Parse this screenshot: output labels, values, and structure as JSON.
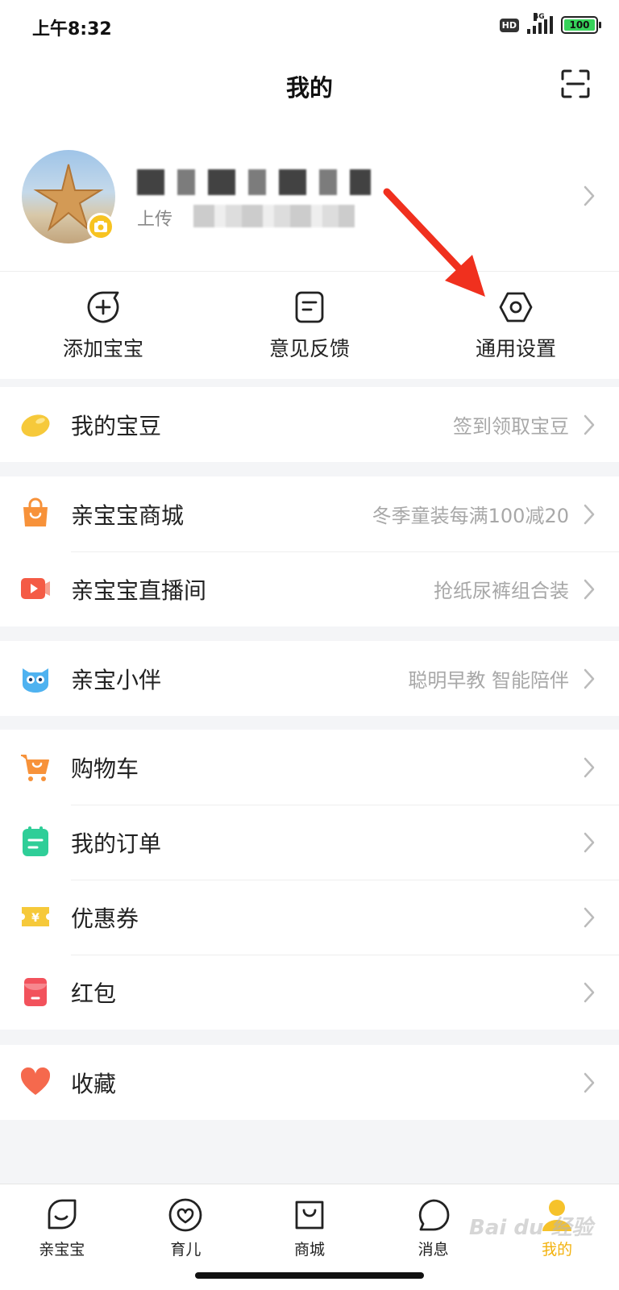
{
  "status": {
    "time": "上午8:32",
    "hd": "HD",
    "network": "4G",
    "battery": "100"
  },
  "header": {
    "title": "我的"
  },
  "profile": {
    "upload_label": "上传"
  },
  "quick_actions": [
    {
      "label": "添加宝宝"
    },
    {
      "label": "意见反馈"
    },
    {
      "label": "通用设置"
    }
  ],
  "menu": {
    "beans": {
      "label": "我的宝豆",
      "hint": "签到领取宝豆"
    },
    "mall": {
      "label": "亲宝宝商城",
      "hint": "冬季童装每满100减20"
    },
    "live": {
      "label": "亲宝宝直播间",
      "hint": "抢纸尿裤组合装"
    },
    "companion": {
      "label": "亲宝小伴",
      "hint": "聪明早教 智能陪伴"
    },
    "cart": {
      "label": "购物车"
    },
    "orders": {
      "label": "我的订单"
    },
    "coupons": {
      "label": "优惠券"
    },
    "redpacket": {
      "label": "红包"
    },
    "favorites": {
      "label": "收藏"
    }
  },
  "tabs": [
    {
      "label": "亲宝宝"
    },
    {
      "label": "育儿"
    },
    {
      "label": "商城"
    },
    {
      "label": "消息"
    },
    {
      "label": "我的"
    }
  ],
  "watermark": "Bai du 经验",
  "colors": {
    "accent": "#f3b20e",
    "arrow": "#f0301e",
    "hint": "#a8a8a8"
  }
}
